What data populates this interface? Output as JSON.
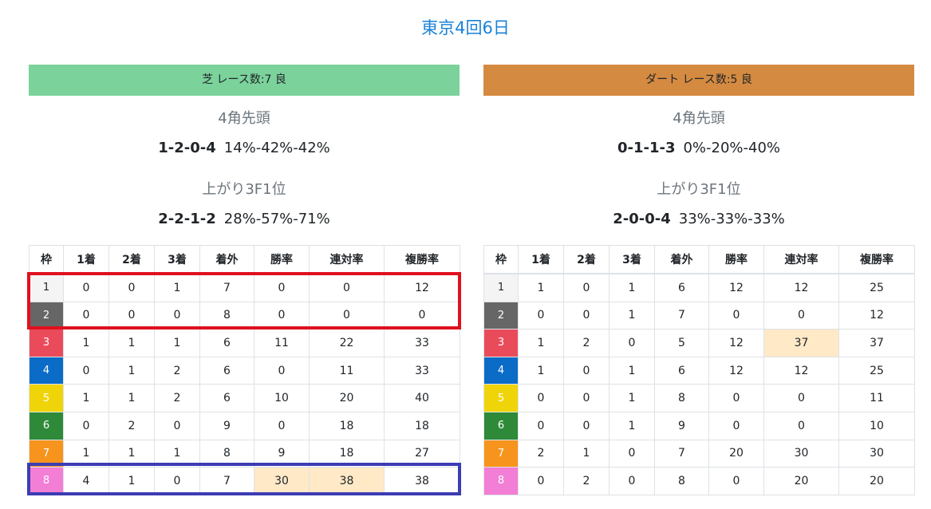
{
  "page_title": "東京4回6日",
  "headers": [
    "枠",
    "1着",
    "2着",
    "3着",
    "着外",
    "勝率",
    "連対率",
    "複勝率"
  ],
  "waku_colors": {
    "1": {
      "bg": "#f4f4f4",
      "fg": "#212529"
    },
    "2": {
      "bg": "#666666",
      "fg": "#ffffff"
    },
    "3": {
      "bg": "#ea4b5b",
      "fg": "#ffffff"
    },
    "4": {
      "bg": "#0b6cc8",
      "fg": "#ffffff"
    },
    "5": {
      "bg": "#f0d40a",
      "fg": "#ffffff"
    },
    "6": {
      "bg": "#2e8a38",
      "fg": "#ffffff"
    },
    "7": {
      "bg": "#f7941d",
      "fg": "#ffffff"
    },
    "8": {
      "bg": "#f27ed6",
      "fg": "#ffffff"
    }
  },
  "highlight_color": "#ffe9c7",
  "turf": {
    "band_label": "芝 レース数:7 良",
    "band_color": "#7bd29b",
    "corner_label": "4角先頭",
    "corner_record": "1-2-0-4",
    "corner_rates": "14%-42%-42%",
    "last3f_label": "上がり3F1位",
    "last3f_record": "2-2-1-2",
    "last3f_rates": "28%-57%-71%",
    "rows": [
      {
        "waku": "1",
        "cells": [
          "0",
          "0",
          "1",
          "7",
          "0",
          "0",
          "12"
        ],
        "hl": []
      },
      {
        "waku": "2",
        "cells": [
          "0",
          "0",
          "0",
          "8",
          "0",
          "0",
          "0"
        ],
        "hl": []
      },
      {
        "waku": "3",
        "cells": [
          "1",
          "1",
          "1",
          "6",
          "11",
          "22",
          "33"
        ],
        "hl": []
      },
      {
        "waku": "4",
        "cells": [
          "0",
          "1",
          "2",
          "6",
          "0",
          "11",
          "33"
        ],
        "hl": []
      },
      {
        "waku": "5",
        "cells": [
          "1",
          "1",
          "2",
          "6",
          "10",
          "20",
          "40"
        ],
        "hl": []
      },
      {
        "waku": "6",
        "cells": [
          "0",
          "2",
          "0",
          "9",
          "0",
          "18",
          "18"
        ],
        "hl": []
      },
      {
        "waku": "7",
        "cells": [
          "1",
          "1",
          "1",
          "8",
          "9",
          "18",
          "27"
        ],
        "hl": []
      },
      {
        "waku": "8",
        "cells": [
          "4",
          "1",
          "0",
          "7",
          "30",
          "38",
          "38"
        ],
        "hl": [
          4,
          5
        ]
      }
    ]
  },
  "dirt": {
    "band_label": "ダート レース数:5 良",
    "band_color": "#d48a40",
    "corner_label": "4角先頭",
    "corner_record": "0-1-1-3",
    "corner_rates": "0%-20%-40%",
    "last3f_label": "上がり3F1位",
    "last3f_record": "2-0-0-4",
    "last3f_rates": "33%-33%-33%",
    "rows": [
      {
        "waku": "1",
        "cells": [
          "1",
          "0",
          "1",
          "6",
          "12",
          "12",
          "25"
        ],
        "hl": []
      },
      {
        "waku": "2",
        "cells": [
          "0",
          "0",
          "1",
          "7",
          "0",
          "0",
          "12"
        ],
        "hl": []
      },
      {
        "waku": "3",
        "cells": [
          "1",
          "2",
          "0",
          "5",
          "12",
          "37",
          "37"
        ],
        "hl": [
          5
        ]
      },
      {
        "waku": "4",
        "cells": [
          "1",
          "0",
          "1",
          "6",
          "12",
          "12",
          "25"
        ],
        "hl": []
      },
      {
        "waku": "5",
        "cells": [
          "0",
          "0",
          "1",
          "8",
          "0",
          "0",
          "11"
        ],
        "hl": []
      },
      {
        "waku": "6",
        "cells": [
          "0",
          "0",
          "1",
          "9",
          "0",
          "0",
          "10"
        ],
        "hl": []
      },
      {
        "waku": "7",
        "cells": [
          "2",
          "1",
          "0",
          "7",
          "20",
          "30",
          "30"
        ],
        "hl": []
      },
      {
        "waku": "8",
        "cells": [
          "0",
          "2",
          "0",
          "8",
          "0",
          "20",
          "20"
        ],
        "hl": []
      }
    ]
  }
}
